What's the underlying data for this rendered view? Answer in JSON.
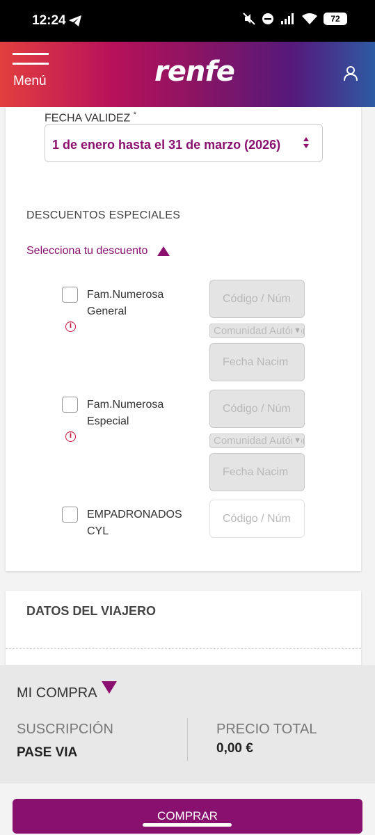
{
  "status_bar": {
    "time": "12:24",
    "battery": "72"
  },
  "header": {
    "menu_label": "Menú",
    "logo": "renfe"
  },
  "validity": {
    "label": "FECHA VALIDEZ",
    "required_mark": "*",
    "value": "1 de enero hasta el 31 de marzo (2026)"
  },
  "discounts": {
    "section_title": "DESCUENTOS ESPECIALES",
    "toggle_label": "Selecciona tu descuento",
    "options": [
      {
        "label": "Fam.Numerosa General",
        "checked": false,
        "code_placeholder": "Código / Núm",
        "region_placeholder": "Comunidad Autónoma",
        "birth_placeholder": "Fecha Nacim"
      },
      {
        "label": "Fam.Numerosa Especial",
        "checked": false,
        "code_placeholder": "Código / Núm",
        "region_placeholder": "Comunidad Autónoma",
        "birth_placeholder": "Fecha Nacim"
      },
      {
        "label": "EMPADRONADOS CYL",
        "checked": false,
        "code_placeholder": "Código / Núm"
      }
    ]
  },
  "traveller": {
    "title": "DATOS DEL VIAJERO"
  },
  "purchase": {
    "title": "MI COMPRA",
    "subscription_label": "SUSCRIPCIÓN",
    "subscription_value": "PASE VIA",
    "total_label": "PRECIO TOTAL",
    "total_value": "0,00 €"
  },
  "buy_button": "COMPRAR",
  "colors": {
    "accent": "#8a1070",
    "info": "#c8103c",
    "header_start": "#e23f3f",
    "header_end": "#2e5aa3"
  },
  "icons": [
    "telegram-icon",
    "mute-icon",
    "dnd-icon",
    "signal-icon",
    "wifi-icon",
    "battery-icon",
    "hamburger-icon",
    "user-icon",
    "sort-icon",
    "info-icon",
    "caret-up-icon",
    "caret-down-icon"
  ]
}
